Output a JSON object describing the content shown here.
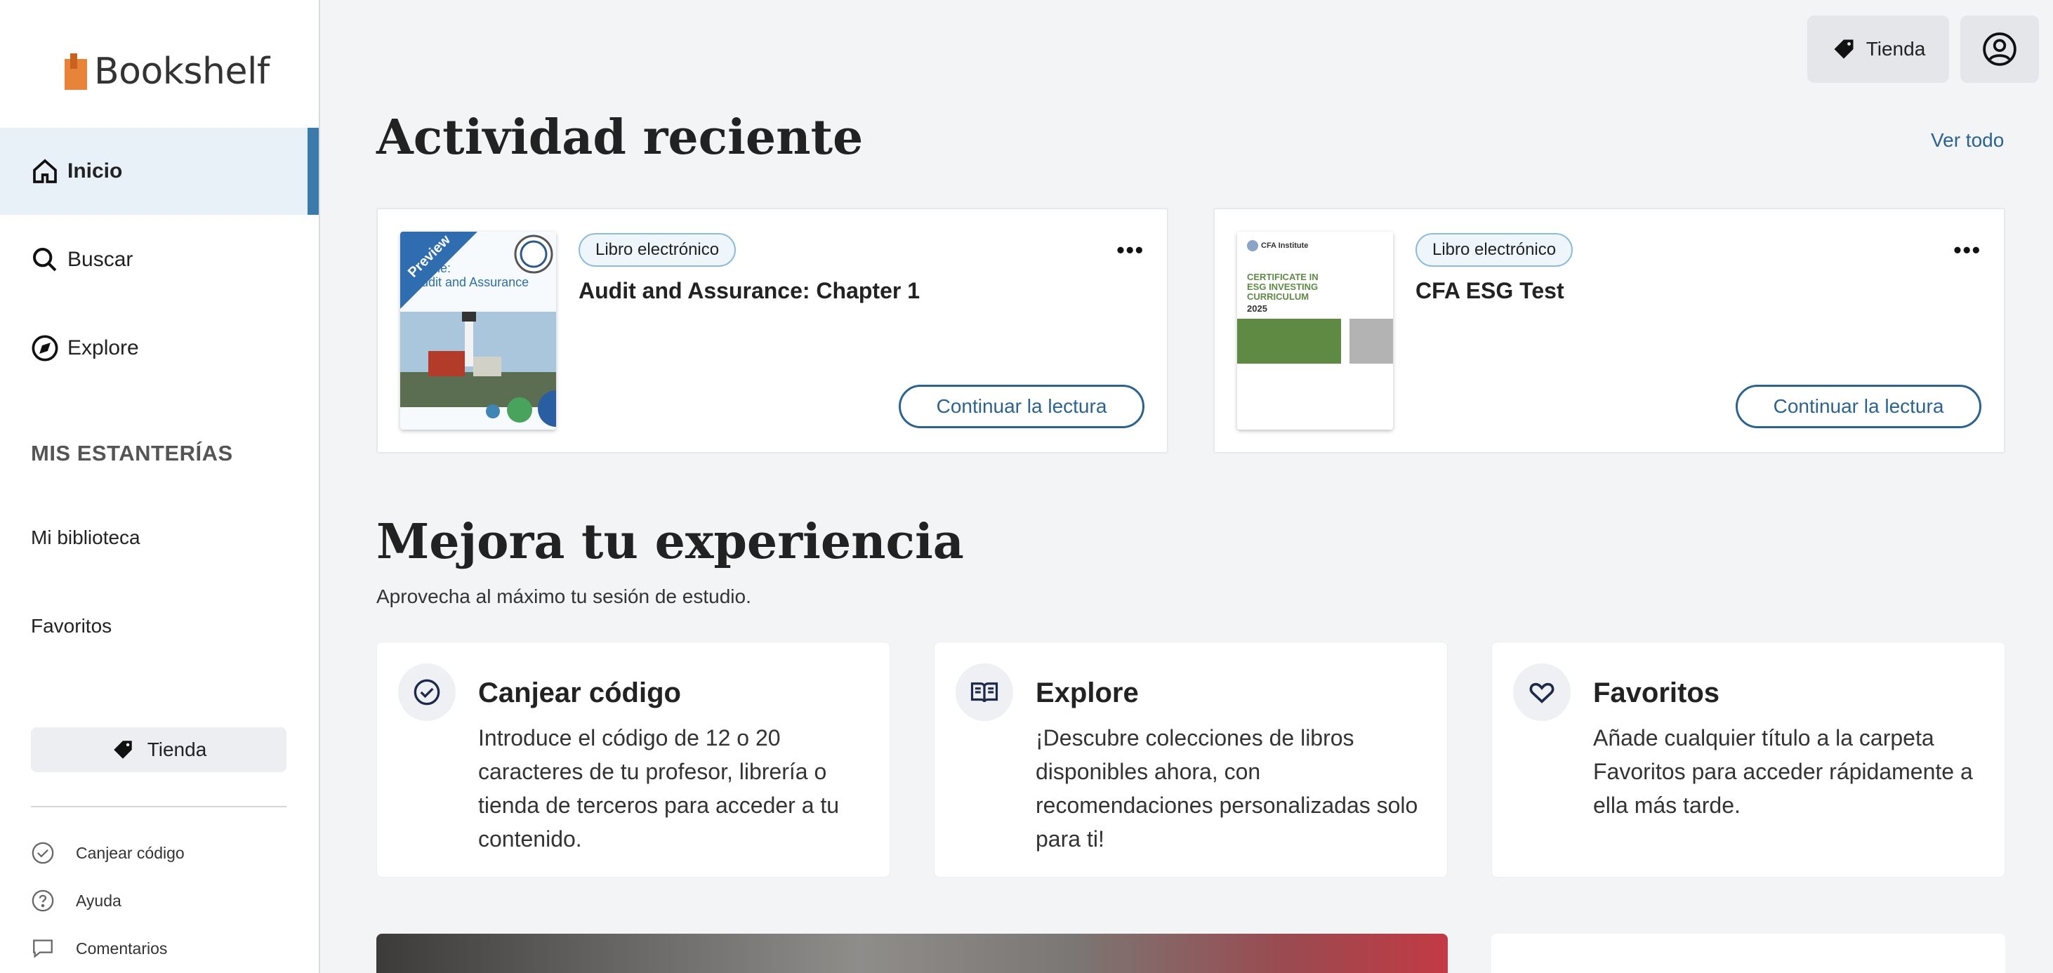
{
  "app": {
    "logo_text": "Bookshelf"
  },
  "sidebar": {
    "nav": [
      {
        "label": "Inicio",
        "icon": "home-icon",
        "active": true
      },
      {
        "label": "Buscar",
        "icon": "search-icon"
      },
      {
        "label": "Explore",
        "icon": "compass-icon"
      }
    ],
    "shelves_heading": "MIS ESTANTERÍAS",
    "shelves": [
      "Mi biblioteca",
      "Favoritos"
    ],
    "store_label": "Tienda",
    "footer": [
      {
        "label": "Canjear código",
        "icon": "check-circle-icon"
      },
      {
        "label": "Ayuda",
        "icon": "help-icon"
      },
      {
        "label": "Comentarios",
        "icon": "comment-icon"
      }
    ]
  },
  "topbar": {
    "store_label": "Tienda",
    "account_icon": "account-icon"
  },
  "recent": {
    "title": "Actividad reciente",
    "see_all": "Ver todo",
    "items": [
      {
        "badge": "Libro electrónico",
        "title": "Audit and Assurance: Chapter 1",
        "action": "Continuar la lectura",
        "cover": {
          "ribbon": "Preview",
          "line1": "ume:",
          "line2": "udit and Assurance"
        }
      },
      {
        "badge": "Libro electrónico",
        "title": "CFA ESG Test",
        "action": "Continuar la lectura",
        "cover": {
          "org": "CFA Institute",
          "heading": "CERTIFICATE IN ESG INVESTING CURRICULUM",
          "year": "2025"
        }
      }
    ]
  },
  "improve": {
    "title": "Mejora tu experiencia",
    "subtitle": "Aprovecha al máximo tu sesión de estudio.",
    "features": [
      {
        "title": "Canjear código",
        "desc": "Introduce el código de 12 o 20 caracteres de tu profesor, librería o tienda de terceros para acceder a tu contenido.",
        "icon": "check-circle-icon"
      },
      {
        "title": "Explore",
        "desc": "¡Descubre colecciones de libros disponibles ahora, con recomendaciones personalizadas solo para ti!",
        "icon": "open-book-icon"
      },
      {
        "title": "Favoritos",
        "desc": "Añade cualquier título a la carpeta Favoritos para acceder rápidamente a ella más tarde.",
        "icon": "heart-icon"
      }
    ]
  },
  "colors": {
    "accent": "#2b6390",
    "active_bar": "#3b7bab",
    "logo": "#e8833a"
  }
}
